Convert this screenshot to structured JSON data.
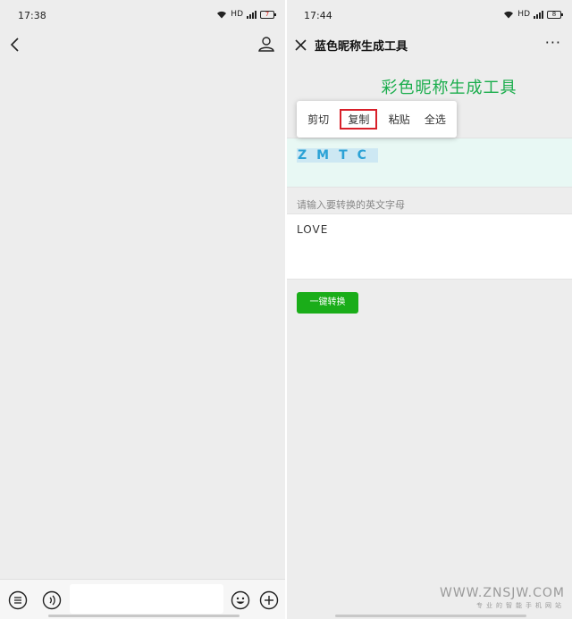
{
  "left_screen": {
    "status": {
      "time": "17:38",
      "network": "HD",
      "battery": "7"
    },
    "navbar": {
      "back_icon": "chevron-left-icon",
      "person_icon": "person-icon"
    },
    "input_bar": {
      "voice_icon": "voice-icon",
      "emoji_icon": "emoji-icon",
      "add_icon": "plus-icon",
      "menu_icon": "menu-list-icon"
    }
  },
  "right_screen": {
    "status": {
      "time": "17:44",
      "network": "HD",
      "battery": "8"
    },
    "navbar": {
      "title": "蓝色昵称生成工具",
      "more": "···"
    },
    "page": {
      "heading": "彩色昵称生成工具",
      "result_text": "ZMTC",
      "input_label": "请输入要转换的英文字母",
      "input_value": "LOVE",
      "convert_button": "一键转换"
    },
    "context_menu": {
      "items": [
        "剪切",
        "复制",
        "粘贴",
        "全选"
      ],
      "highlighted_index": 1,
      "highlight_color": "#d8202a"
    }
  },
  "watermark": {
    "main": "WWW.ZNSJW.COM",
    "sub": "专业的智能手机网站"
  },
  "colors": {
    "accent_green": "#1aad19",
    "title_green": "#1aad4c",
    "result_blue": "#2ba2d6"
  }
}
